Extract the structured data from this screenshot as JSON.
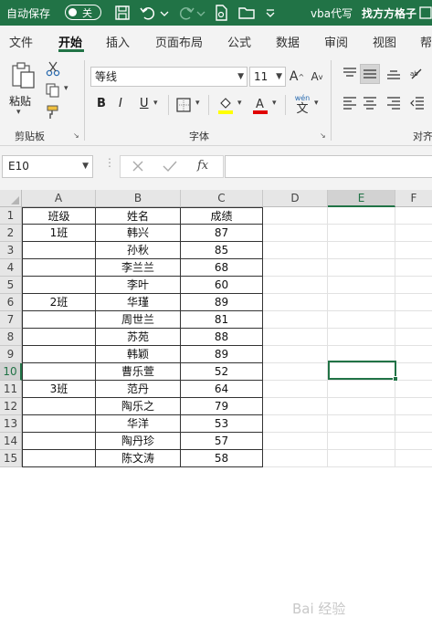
{
  "titlebar": {
    "autosave_label": "自动保存",
    "autosave_state": "关",
    "doc_title": "vba代写",
    "user_name": "找方方格子",
    "accent_color": "#217346"
  },
  "tabs": [
    "文件",
    "开始",
    "插入",
    "页面布局",
    "公式",
    "数据",
    "审阅",
    "视图",
    "帮"
  ],
  "active_tab": "开始",
  "ribbon": {
    "clipboard": {
      "paste_label": "粘贴",
      "group_label": "剪贴板"
    },
    "font": {
      "font_name": "等线",
      "font_size": "11",
      "bold": "B",
      "italic": "I",
      "underline": "U",
      "wen_label": "wén",
      "wen_char": "文",
      "group_label": "字体"
    },
    "alignment": {
      "group_label": "对齐"
    }
  },
  "formula_bar": {
    "name_box": "E10",
    "fx_label": "fx",
    "formula": ""
  },
  "columns": [
    "A",
    "B",
    "C",
    "D",
    "E",
    "F"
  ],
  "selected_column": "E",
  "selected_row": "10",
  "rows": [
    {
      "n": "1",
      "a": "班级",
      "b": "姓名",
      "c": "成绩"
    },
    {
      "n": "2",
      "a": "1班",
      "b": "韩兴",
      "c": "87"
    },
    {
      "n": "3",
      "a": "",
      "b": "孙秋",
      "c": "85"
    },
    {
      "n": "4",
      "a": "",
      "b": "李兰兰",
      "c": "68"
    },
    {
      "n": "5",
      "a": "",
      "b": "李叶",
      "c": "60"
    },
    {
      "n": "6",
      "a": "2班",
      "b": "华瑾",
      "c": "89"
    },
    {
      "n": "7",
      "a": "",
      "b": "周世兰",
      "c": "81"
    },
    {
      "n": "8",
      "a": "",
      "b": "苏苑",
      "c": "88"
    },
    {
      "n": "9",
      "a": "",
      "b": "韩颖",
      "c": "89"
    },
    {
      "n": "10",
      "a": "",
      "b": "曹乐萱",
      "c": "52"
    },
    {
      "n": "11",
      "a": "3班",
      "b": "范丹",
      "c": "64"
    },
    {
      "n": "12",
      "a": "",
      "b": "陶乐之",
      "c": "79"
    },
    {
      "n": "13",
      "a": "",
      "b": "华洋",
      "c": "53"
    },
    {
      "n": "14",
      "a": "",
      "b": "陶丹珍",
      "c": "57"
    },
    {
      "n": "15",
      "a": "",
      "b": "陈文涛",
      "c": "58"
    }
  ],
  "watermark": "Bai 经验"
}
